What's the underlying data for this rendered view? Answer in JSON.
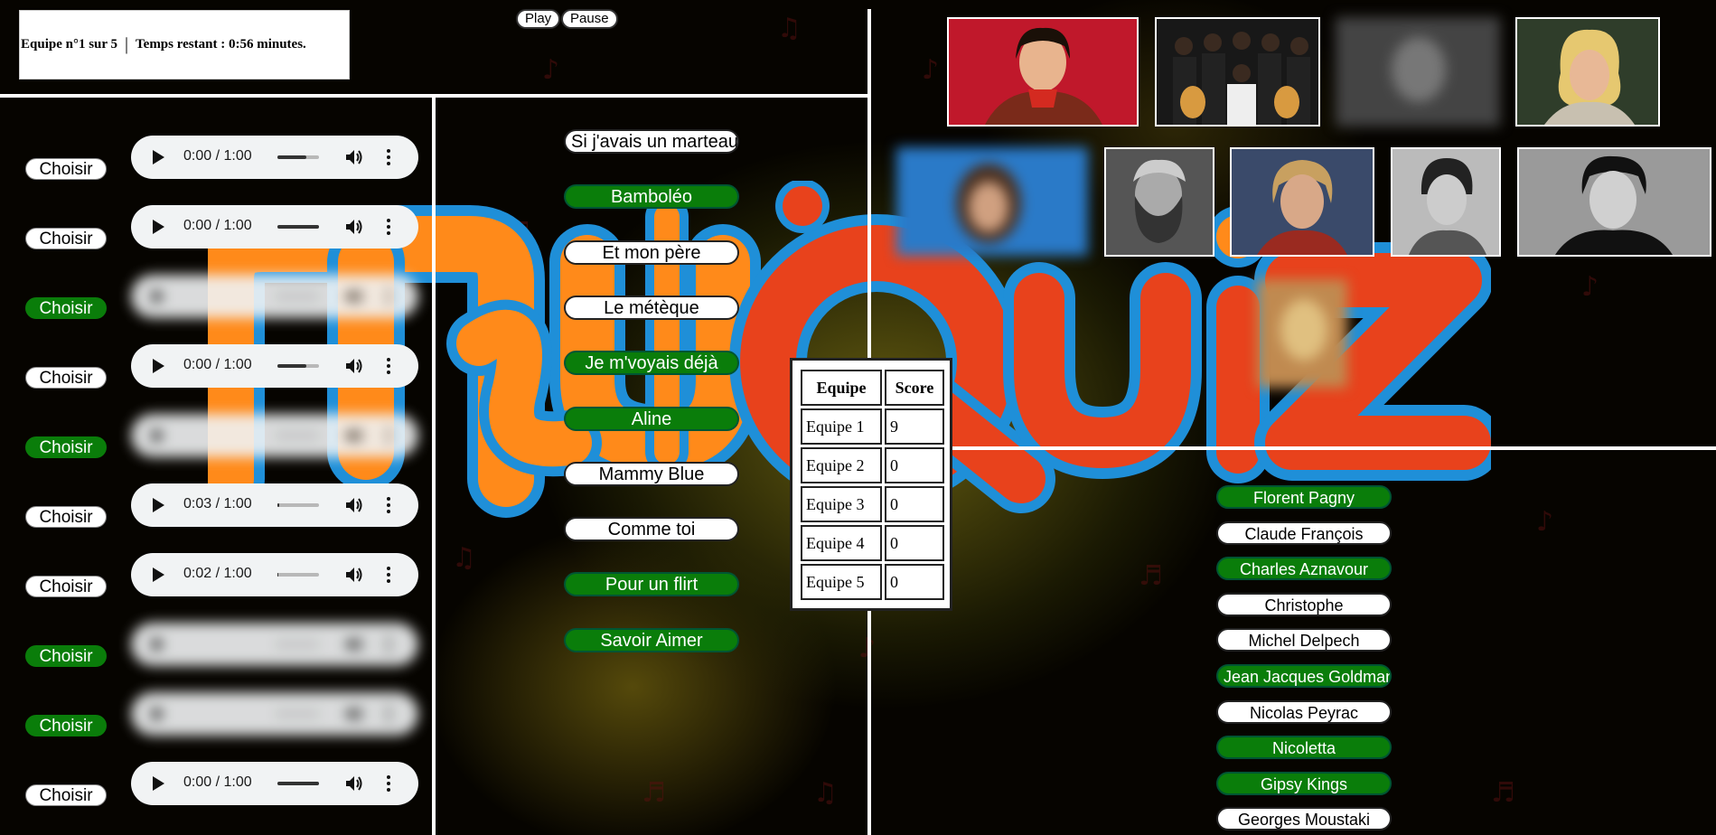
{
  "status": {
    "team_text": "Equipe n°1 sur 5",
    "separator": "|",
    "time_text": "Temps restant : 0:56 minutes."
  },
  "controls": {
    "play_label": "Play",
    "pause_label": "Pause"
  },
  "rounds": [
    {
      "choose_label": "Choisir",
      "selected": false,
      "time": "0:00 / 1:00",
      "progress": 0.0,
      "blurred": false
    },
    {
      "choose_label": "Choisir",
      "selected": false,
      "time": "0:00 / 1:00",
      "progress": 0.0,
      "blurred": false
    },
    {
      "choose_label": "Choisir",
      "selected": true,
      "time": "",
      "progress": 0.0,
      "blurred": true
    },
    {
      "choose_label": "Choisir",
      "selected": false,
      "time": "0:00 / 1:00",
      "progress": 0.0,
      "blurred": false
    },
    {
      "choose_label": "Choisir",
      "selected": true,
      "time": "",
      "progress": 0.0,
      "blurred": true
    },
    {
      "choose_label": "Choisir",
      "selected": false,
      "time": "0:03 / 1:00",
      "progress": 0.05,
      "blurred": false
    },
    {
      "choose_label": "Choisir",
      "selected": false,
      "time": "0:02 / 1:00",
      "progress": 0.03,
      "blurred": false
    },
    {
      "choose_label": "Choisir",
      "selected": true,
      "time": "",
      "progress": 0.0,
      "blurred": true
    },
    {
      "choose_label": "Choisir",
      "selected": true,
      "time": "",
      "progress": 0.0,
      "blurred": true
    },
    {
      "choose_label": "Choisir",
      "selected": false,
      "time": "0:00 / 1:00",
      "progress": 0.0,
      "blurred": false
    }
  ],
  "songs": [
    {
      "title": "Si j'avais un marteau",
      "found": false
    },
    {
      "title": "Bamboléo",
      "found": true
    },
    {
      "title": "Et mon père",
      "found": false
    },
    {
      "title": "Le métèque",
      "found": false
    },
    {
      "title": "Je m'voyais déjà",
      "found": true
    },
    {
      "title": "Aline",
      "found": true
    },
    {
      "title": "Mammy Blue",
      "found": false
    },
    {
      "title": "Comme toi",
      "found": false
    },
    {
      "title": "Pour un flirt",
      "found": true
    },
    {
      "title": "Savoir Aimer",
      "found": true
    }
  ],
  "scoreboard": {
    "headers": [
      "Equipe",
      "Score"
    ],
    "rows": [
      {
        "team": "Equipe 1",
        "score": "9"
      },
      {
        "team": "Equipe 2",
        "score": "0"
      },
      {
        "team": "Equipe 3",
        "score": "0"
      },
      {
        "team": "Equipe 4",
        "score": "0"
      },
      {
        "team": "Equipe 5",
        "score": "0"
      }
    ]
  },
  "artists": [
    {
      "name": "Florent Pagny",
      "found": true
    },
    {
      "name": "Claude François",
      "found": false
    },
    {
      "name": "Charles Aznavour",
      "found": true
    },
    {
      "name": "Christophe",
      "found": false
    },
    {
      "name": "Michel Delpech",
      "found": false
    },
    {
      "name": "Jean Jacques Goldman",
      "found": true
    },
    {
      "name": "Nicolas Peyrac",
      "found": false
    },
    {
      "name": "Nicoletta",
      "found": true
    },
    {
      "name": "Gipsy Kings",
      "found": true
    },
    {
      "name": "Georges Moustaki",
      "found": false
    }
  ],
  "colors": {
    "found": "#0a7d0a",
    "neutral": "#ffffff",
    "logo_orange": "#ff8a1a",
    "logo_red": "#e8421c",
    "logo_outline": "#1f8fd8"
  }
}
